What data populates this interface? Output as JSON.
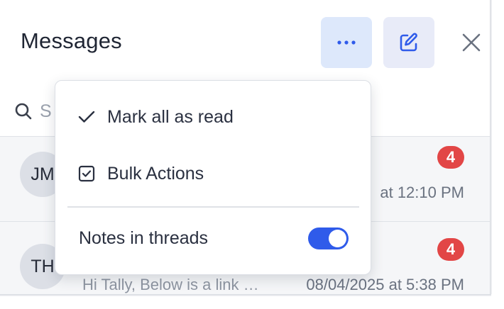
{
  "header": {
    "title": "Messages"
  },
  "toolbar": {
    "more_icon": "more-horizontal-icon",
    "compose_icon": "compose-icon",
    "close_icon": "close-icon"
  },
  "search": {
    "placeholder_visible": "S"
  },
  "conversations": [
    {
      "initials": "JM",
      "badge": "4",
      "time": "at 12:10 PM",
      "preview": ""
    },
    {
      "initials": "TH",
      "badge": "4",
      "time": "08/04/2025 at 5:38 PM",
      "preview": "Hi Tally, Below is a link …"
    }
  ],
  "menu": {
    "items": [
      {
        "label": "Mark all as read",
        "icon": "check-icon"
      },
      {
        "label": "Bulk Actions",
        "icon": "checkbox-icon"
      }
    ],
    "toggle_item": {
      "label": "Notes in threads",
      "enabled": true
    }
  },
  "colors": {
    "accent": "#2f5bea",
    "badge": "#e24646",
    "more_button_bg": "#dde8fb",
    "compose_button_bg": "#e8ebf8"
  }
}
